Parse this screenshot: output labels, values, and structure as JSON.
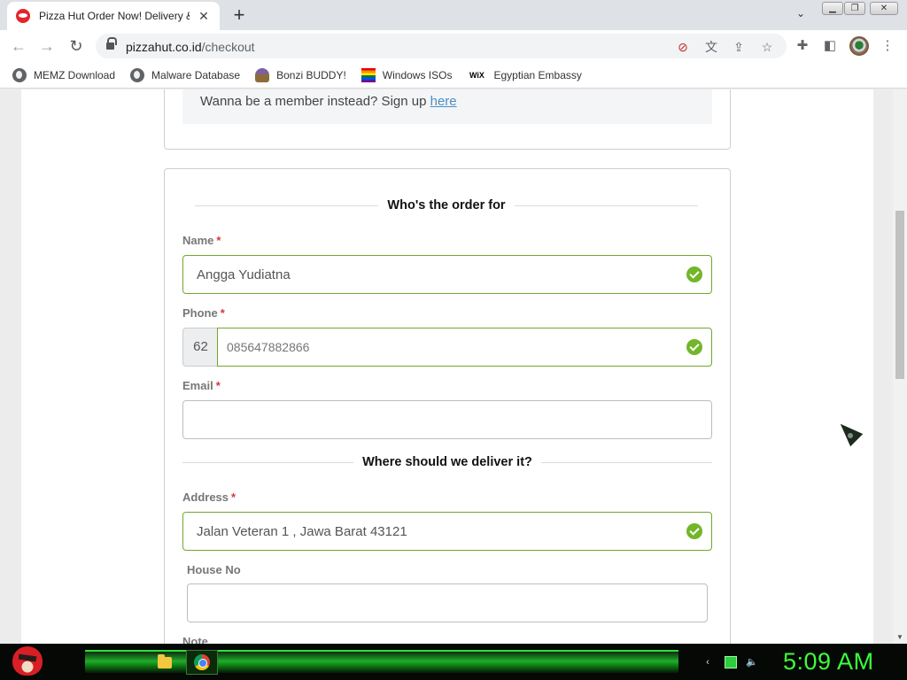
{
  "browser": {
    "tab_title": "Pizza Hut Order Now! Delivery &",
    "tab_close": "✕",
    "new_tab": "+",
    "url_host": "pizzahut.co.id",
    "url_path": "/checkout",
    "bookmarks": [
      {
        "label": "MEMZ Download",
        "icon": "globe-icon"
      },
      {
        "label": "Malware Database",
        "icon": "globe-icon"
      },
      {
        "label": "Bonzi BUDDY!",
        "icon": "bonzi-icon"
      },
      {
        "label": "Windows ISOs",
        "icon": "rainbow-flag-icon"
      },
      {
        "label": "Egyptian Embassy",
        "icon": "wix-icon"
      }
    ],
    "wix_text": "WiX"
  },
  "page": {
    "member_text": "Wanna be a member instead? Sign up ",
    "member_link": "here",
    "section_order_for": "Who's the order for",
    "name_label": "Name",
    "name_value": "Angga Yudiatna",
    "phone_label": "Phone",
    "phone_prefix": "62",
    "phone_value": "085647882866",
    "email_label": "Email",
    "email_value": "",
    "section_deliver": "Where should we deliver it?",
    "address_label": "Address",
    "address_value": "Jalan Veteran 1 , Jawa Barat 43121",
    "house_label": "House No",
    "house_value": "",
    "note_label": "Note",
    "required_mark": "*",
    "accent_valid": "#6fa82b",
    "check_color": "#72b629"
  },
  "taskbar": {
    "clock": "5:09 AM",
    "accent": "#3bff3b"
  }
}
